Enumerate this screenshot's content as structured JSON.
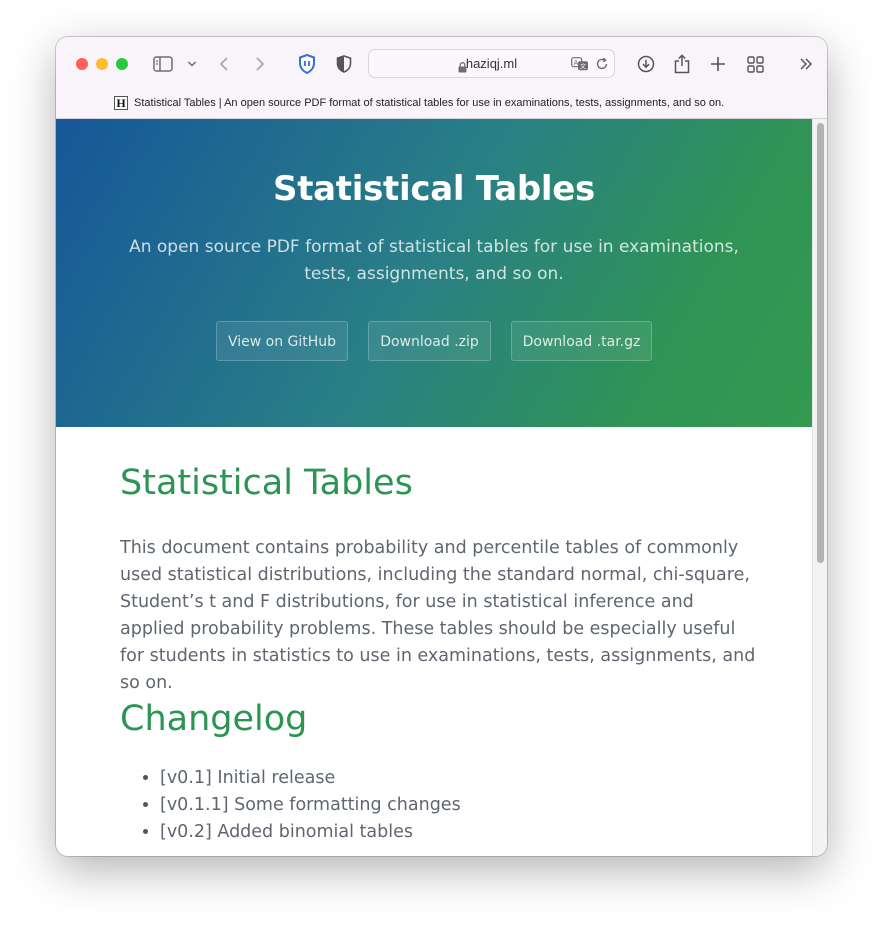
{
  "browser": {
    "url_host": "haziqj.ml",
    "tab_title": "Statistical Tables | An open source PDF format of statistical tables for use in examinations, tests, assignments, and so on.",
    "favicon_letter": "H",
    "icons": [
      "sidebar-icon",
      "chevron-down-icon",
      "back-icon",
      "forward-icon",
      "privacy-shield-icon",
      "half-shield-icon",
      "lock-icon",
      "translate-icon",
      "reload-icon",
      "download-icon",
      "share-icon",
      "plus-icon",
      "tab-overview-icon",
      "more-chevrons-icon"
    ]
  },
  "hero": {
    "title": "Statistical Tables",
    "tagline": "An open source PDF format of statistical tables for use in examinations, tests, assignments, and so on.",
    "buttons": [
      "View on GitHub",
      "Download .zip",
      "Download .tar.gz"
    ]
  },
  "main": {
    "heading": "Statistical Tables",
    "paragraph": "This document contains probability and percentile tables of commonly used statistical distributions, including the standard normal, chi-square, Student’s t and F distributions, for use in statistical inference and applied probability problems. These tables should be especially useful for students in statistics to use in examinations, tests, assignments, and so on.",
    "changelog_heading": "Changelog",
    "changelog": [
      "[v0.1] Initial release",
      "[v0.1.1] Some formatting changes",
      "[v0.2] Added binomial tables"
    ]
  },
  "colors": {
    "heading_green": "#2c9553",
    "hero_gradient_start": "#155799",
    "hero_gradient_end": "#339a50",
    "text_gray": "#5f6670"
  }
}
